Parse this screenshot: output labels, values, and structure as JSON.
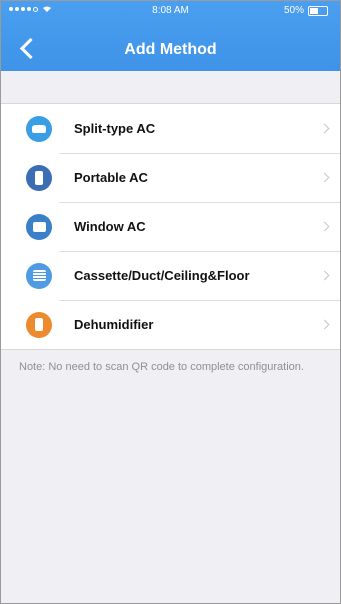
{
  "status_bar": {
    "time": "8:08 AM",
    "battery": "50%",
    "battery_level": 0.5
  },
  "header": {
    "title": "Add Method"
  },
  "methods": [
    {
      "label": "Split-type AC",
      "icon": "split-ac-icon",
      "color": "#3a9ee5"
    },
    {
      "label": "Portable AC",
      "icon": "portable-ac-icon",
      "color": "#3b6db5"
    },
    {
      "label": "Window AC",
      "icon": "window-ac-icon",
      "color": "#3a7fc8"
    },
    {
      "label": "Cassette/Duct/Ceiling&Floor",
      "icon": "cassette-ac-icon",
      "color": "#4f9be3"
    },
    {
      "label": "Dehumidifier",
      "icon": "dehumidifier-icon",
      "color": "#ee8a2e"
    }
  ],
  "note": "Note: No need to scan QR code to complete configuration."
}
